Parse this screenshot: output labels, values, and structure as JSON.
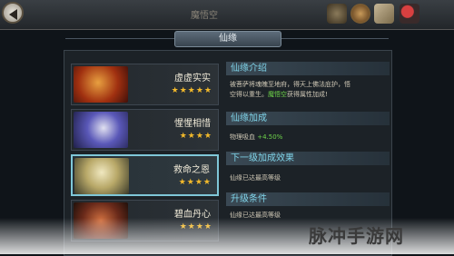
{
  "header": {
    "title": "魔悟空",
    "tab_label": "仙缘"
  },
  "toolbar_icons": [
    "scroll-icon",
    "coin-icon",
    "map-icon",
    "magnifier-icon"
  ],
  "list": [
    {
      "name": "虚虚实实",
      "stars": "★★★★★",
      "rating": 5
    },
    {
      "name": "惺惺相惜",
      "stars": "★★★★",
      "rating": 4
    },
    {
      "name": "救命之恩",
      "stars": "★★★★",
      "rating": 4
    },
    {
      "name": "碧血丹心",
      "stars": "★★★★",
      "rating": 4
    }
  ],
  "panel": {
    "intro_title": "仙缘介绍",
    "intro_text_1": "被菩萨将魂魄至地府，得天上佛法庇护，悟",
    "intro_text_2": "空得以重生。",
    "intro_hero": "魔悟空",
    "intro_text_3": "获得属性加成!",
    "bonus_title": "仙缘加成",
    "bonus_label": "物理吸血",
    "bonus_value": "+4.50%",
    "next_title": "下一级加成效果",
    "next_text": "仙缘已达最高等级",
    "upgrade_title": "升级条件",
    "upgrade_text": "仙缘已达最高等级"
  },
  "watermark": "脉冲手游网",
  "colors": {
    "accent_cyan": "#7fd3e8",
    "star_gold": "#f2b92b",
    "highlight_green": "#6ed34a"
  }
}
